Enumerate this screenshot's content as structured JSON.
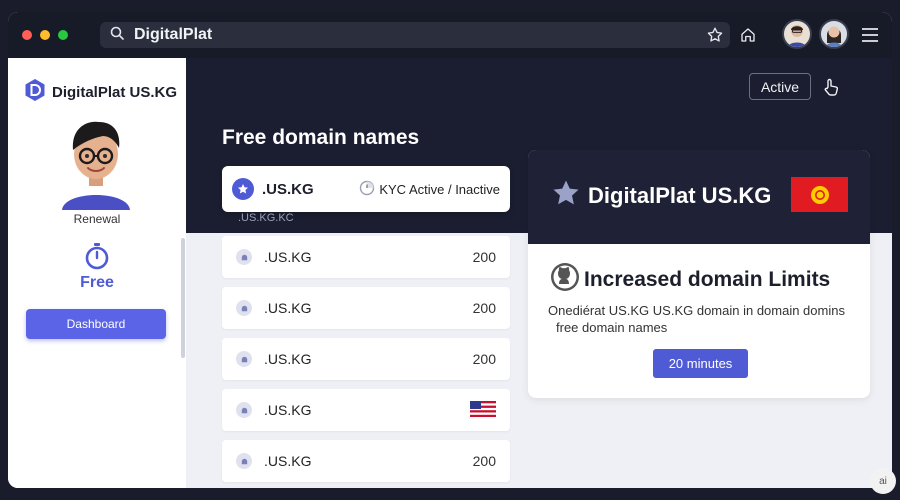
{
  "browser": {
    "url_text": "DigitalPlat",
    "dot_colors": [
      "#ff5f57",
      "#febc2e",
      "#28c840"
    ]
  },
  "sidebar": {
    "brand": "DigitalPlat US.KG",
    "renewal_label": "Renewal",
    "plan_label": "Free",
    "dashboard_button": "Dashboard"
  },
  "header": {
    "status_button": "Active"
  },
  "main": {
    "heading": "Free domain names",
    "first_item": {
      "label": ".US.KG",
      "kyc": "KYC Active / Inactive",
      "ghost_text": ".US.KG.KC"
    },
    "items": [
      {
        "label": ".US.KG",
        "value": "200"
      },
      {
        "label": ".US.KG",
        "value": "200"
      },
      {
        "label": ".US.KG",
        "value": "200"
      },
      {
        "label": ".US.KG",
        "value": ""
      },
      {
        "label": ".US.KG",
        "value": "200"
      }
    ]
  },
  "card": {
    "brand": "DigitalPlat US.KG",
    "title": "Increased domain Limits",
    "line1": "Onediérat US.KG US.KG domain in domain domins",
    "line2": "free domain names",
    "button": "20 minutes"
  },
  "colors": {
    "accent": "#4f5bd5",
    "dark": "#1b1e30",
    "flag_red": "#e11b22"
  },
  "corner_badge": "ai"
}
